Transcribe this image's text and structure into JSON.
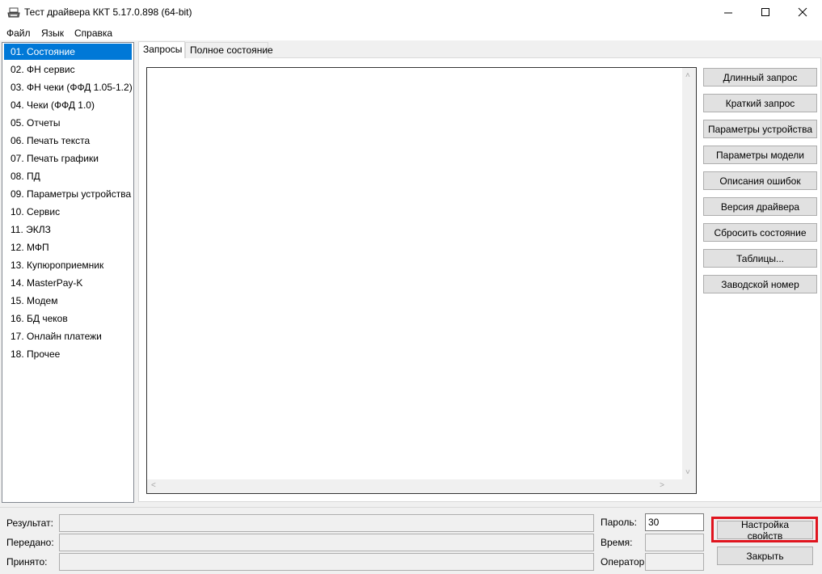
{
  "window": {
    "title": "Тест драйвера ККТ 5.17.0.898 (64-bit)",
    "controls": [
      "minimize",
      "maximize",
      "close"
    ]
  },
  "menu": {
    "items": [
      "Файл",
      "Язык",
      "Справка"
    ]
  },
  "nav": {
    "selected_index": 0,
    "items": [
      "01. Состояние",
      "02. ФН сервис",
      "03. ФН чеки (ФФД 1.05-1.2)",
      "04. Чеки (ФФД 1.0)",
      "05. Отчеты",
      "06. Печать текста",
      "07. Печать графики",
      "08. ПД",
      "09. Параметры устройства",
      "10. Сервис",
      "11. ЭКЛЗ",
      "12. МФП",
      "13. Купюроприемник",
      "14. MasterPay-K",
      "15. Модем",
      "16. БД чеков",
      "17. Онлайн платежи",
      "18. Прочее"
    ]
  },
  "tabs": {
    "active_index": 0,
    "items": [
      "Запросы",
      "Полное состояние"
    ]
  },
  "side_buttons": [
    "Длинный запрос",
    "Краткий запрос",
    "Параметры устройства",
    "Параметры модели",
    "Описания ошибок",
    "Версия драйвера",
    "Сбросить состояние",
    "Таблицы...",
    "Заводской номер"
  ],
  "status": {
    "result_label": "Результат:",
    "sent_label": "Передано:",
    "received_label": "Принято:",
    "password_label": "Пароль:",
    "password_value": "30",
    "time_label": "Время:",
    "operator_label": "Оператор:"
  },
  "bottom_buttons": {
    "settings": "Настройка свойств",
    "close": "Закрыть"
  },
  "colors": {
    "selection": "#0078d7",
    "highlight_box": "#e0141e"
  }
}
